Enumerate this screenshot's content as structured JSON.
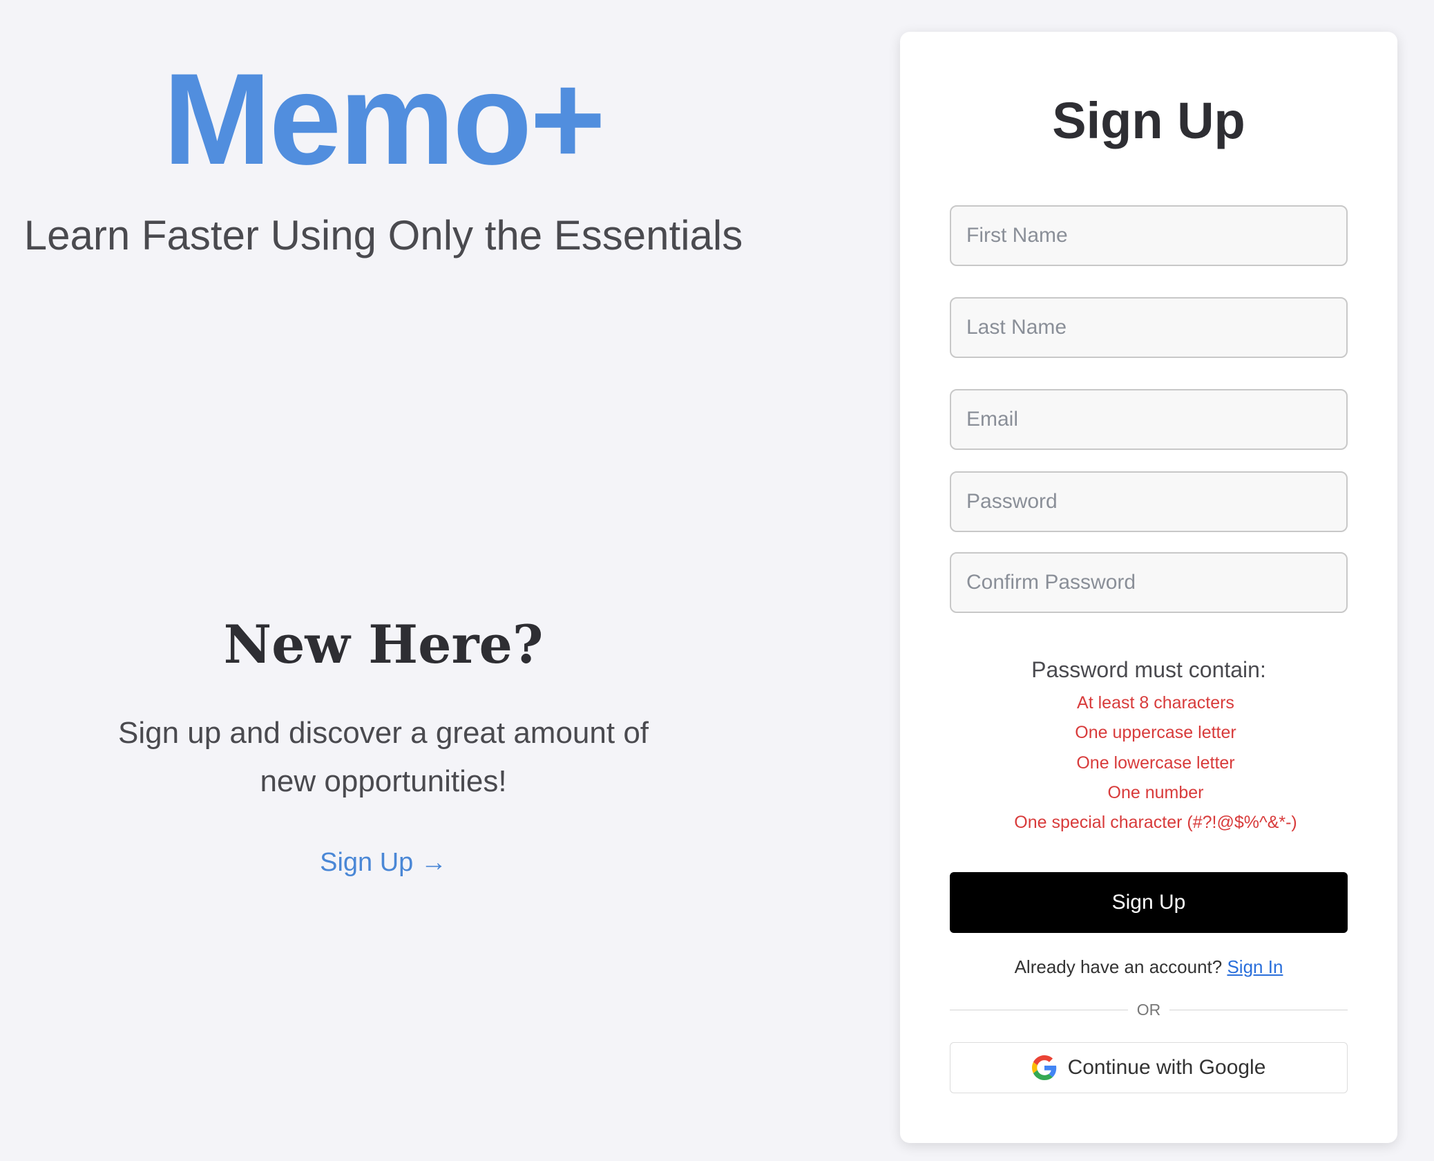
{
  "brand": {
    "logo": "Memo+",
    "tagline": "Learn Faster Using Only the Essentials",
    "logo_color": "#518ede"
  },
  "promo": {
    "heading": "New Here?",
    "description": "Sign up and discover a great amount of new opportunities!",
    "link_label": "Sign Up →"
  },
  "form": {
    "title": "Sign Up",
    "fields": {
      "first_name": {
        "placeholder": "First Name",
        "value": ""
      },
      "last_name": {
        "placeholder": "Last Name",
        "value": ""
      },
      "email": {
        "placeholder": "Email",
        "value": ""
      },
      "password": {
        "placeholder": "Password",
        "value": ""
      },
      "confirm_password": {
        "placeholder": "Confirm Password",
        "value": ""
      }
    },
    "requirements_title": "Password must contain:",
    "requirements": [
      "At least 8 characters",
      "One uppercase letter",
      "One lowercase letter",
      "One number",
      "One special character (#?!@$%^&*-)"
    ],
    "requirement_color": "#d83b3b",
    "submit_label": "Sign Up",
    "already_text": "Already have an account?",
    "signin_label": "Sign In",
    "divider_label": "OR",
    "google_label": "Continue with Google",
    "google_icon": "google-g-icon"
  }
}
